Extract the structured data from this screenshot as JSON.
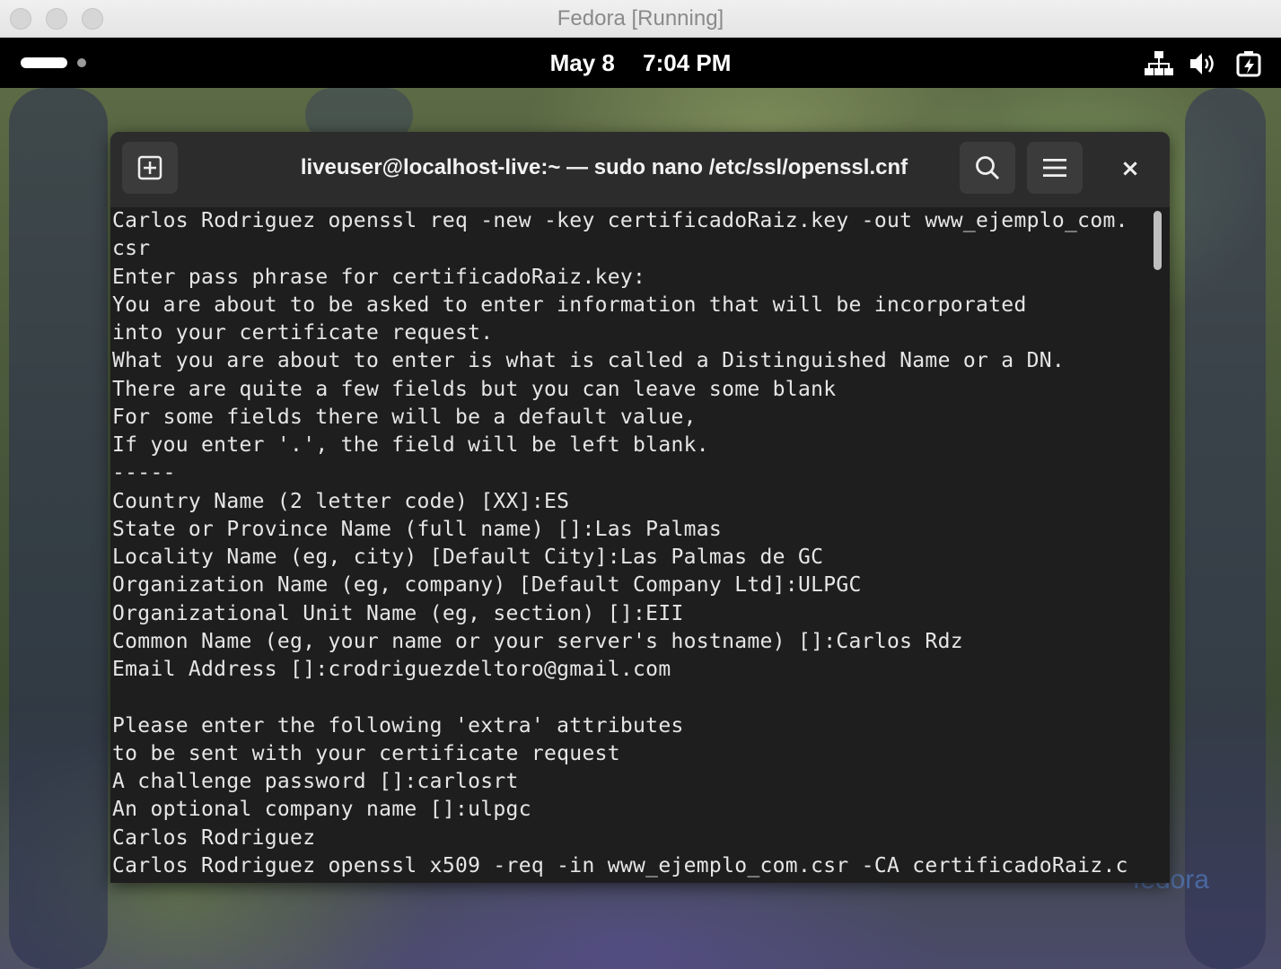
{
  "host_window": {
    "title": "Fedora [Running]"
  },
  "top_bar": {
    "date": "May 8",
    "time": "7:04 PM",
    "tray_icons": [
      "network-icon",
      "volume-icon",
      "battery-icon"
    ]
  },
  "terminal": {
    "title": "liveuser@localhost-live:~ — sudo nano /etc/ssl/openssl.cnf",
    "new_tab_icon": "new-tab-icon",
    "search_icon": "search-icon",
    "menu_icon": "hamburger-menu-icon",
    "close_label": "×",
    "lines": [
      "Carlos Rodriguez openssl req -new -key certificadoRaiz.key -out www_ejemplo_com.",
      "csr",
      "Enter pass phrase for certificadoRaiz.key:",
      "You are about to be asked to enter information that will be incorporated",
      "into your certificate request.",
      "What you are about to enter is what is called a Distinguished Name or a DN.",
      "There are quite a few fields but you can leave some blank",
      "For some fields there will be a default value,",
      "If you enter '.', the field will be left blank.",
      "-----",
      "Country Name (2 letter code) [XX]:ES",
      "State or Province Name (full name) []:Las Palmas",
      "Locality Name (eg, city) [Default City]:Las Palmas de GC",
      "Organization Name (eg, company) [Default Company Ltd]:ULPGC",
      "Organizational Unit Name (eg, section) []:EII",
      "Common Name (eg, your name or your server's hostname) []:Carlos Rdz",
      "Email Address []:crodriguezdeltoro@gmail.com",
      "",
      "Please enter the following 'extra' attributes",
      "to be sent with your certificate request",
      "A challenge password []:carlosrt",
      "An optional company name []:ulpgc",
      "Carlos Rodriguez",
      "Carlos Rodriguez openssl x509 -req -in www_ejemplo_com.csr -CA certificadoRaiz.c"
    ]
  },
  "wallpaper": {
    "watermark": "fedora"
  },
  "colors": {
    "terminal_bg": "#1e1e1e",
    "header_bg": "#2c2c2c",
    "text": "#e6e6e6",
    "top_bar_bg": "#000000"
  }
}
